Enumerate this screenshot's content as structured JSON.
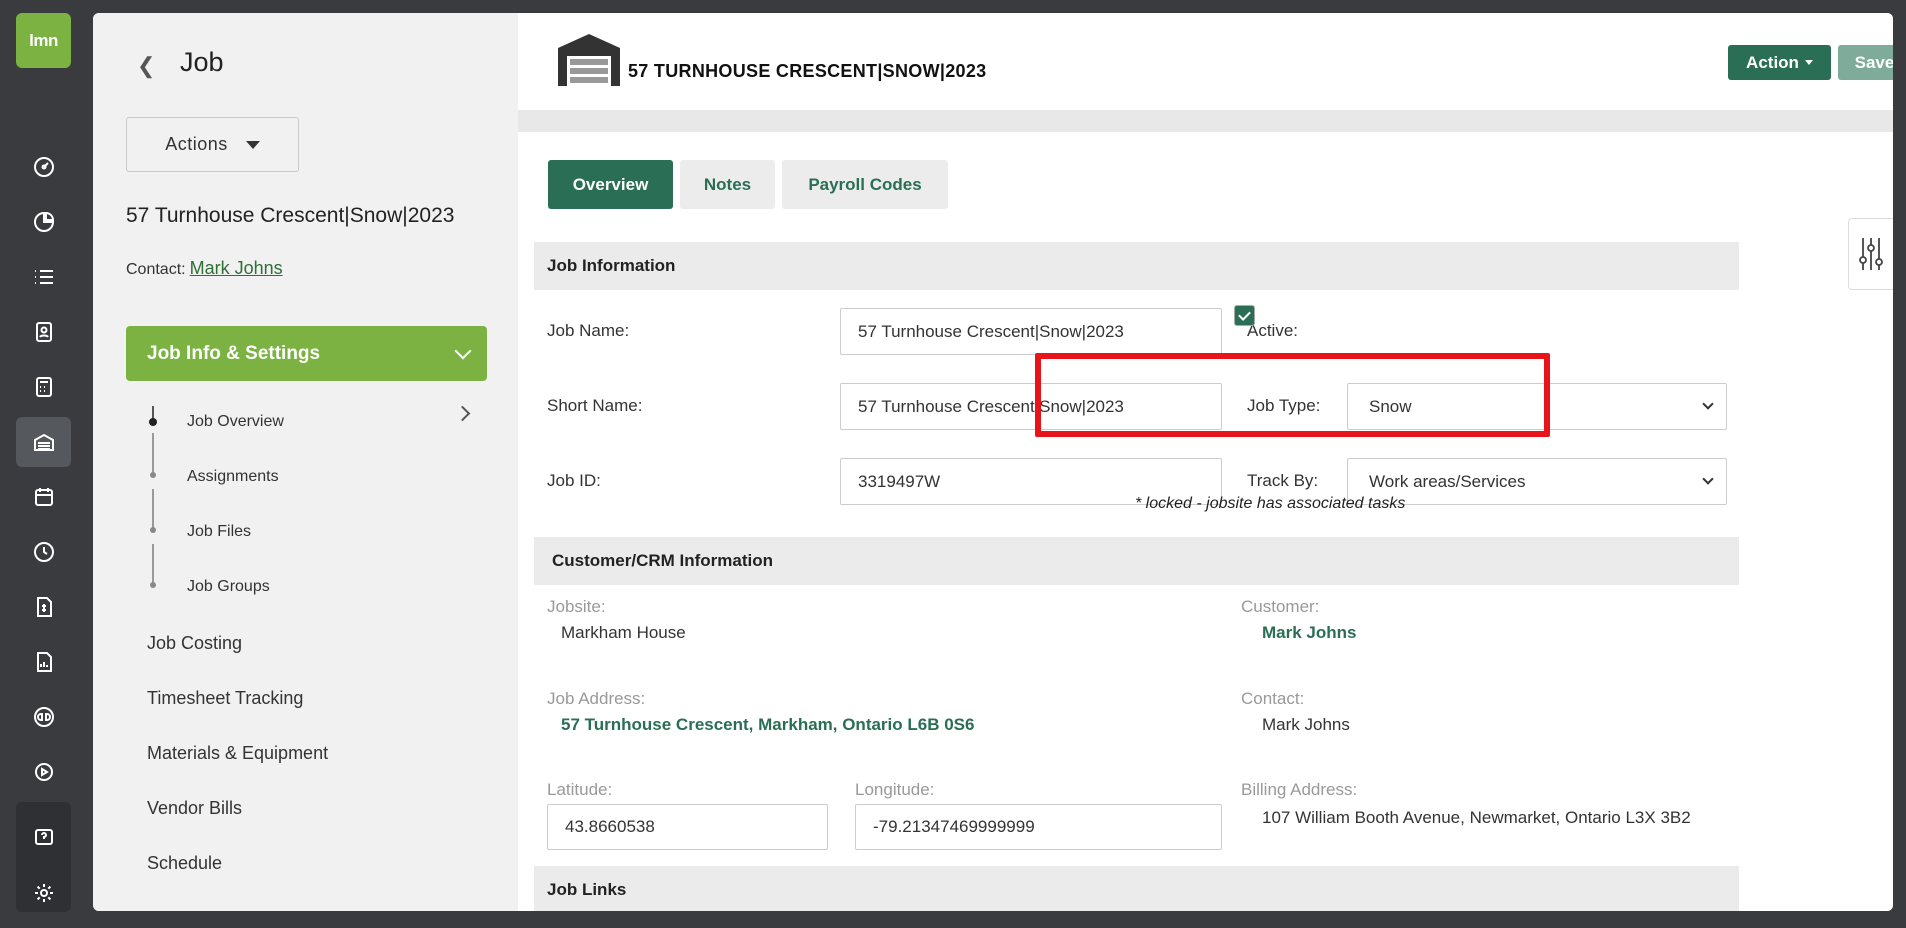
{
  "app": {
    "logo_text": "lmn"
  },
  "rail": {
    "icons": [
      "dashboard-icon",
      "chart-pie-icon",
      "list-icon",
      "contact-card-icon",
      "calculator-icon",
      "garage-icon",
      "calendar-icon",
      "clock-icon",
      "invoice-icon",
      "report-icon",
      "quickbooks-icon",
      "play-icon",
      "help-icon",
      "settings-icon"
    ],
    "active": "garage-icon"
  },
  "nav": {
    "title": "Job",
    "actions_label": "Actions",
    "job_name": "57 Turnhouse Crescent|Snow|2023",
    "contact_label": "Contact:",
    "contact_name": "Mark Johns",
    "section_label": "Job Info & Settings",
    "sub_items": [
      "Job Overview",
      "Assignments",
      "Job Files",
      "Job Groups"
    ],
    "items": [
      "Job Costing",
      "Timesheet Tracking",
      "Materials & Equipment",
      "Vendor Bills",
      "Schedule"
    ]
  },
  "header": {
    "title": "57 TURNHOUSE CRESCENT|SNOW|2023",
    "action_label": "Action",
    "save_label": "Save"
  },
  "tabs": [
    {
      "label": "Overview",
      "active": true
    },
    {
      "label": "Notes",
      "active": false
    },
    {
      "label": "Payroll Codes",
      "active": false
    }
  ],
  "job_info": {
    "heading": "Job Information",
    "job_name_label": "Job Name:",
    "job_name_value": "57 Turnhouse Crescent|Snow|2023",
    "short_name_label": "Short Name:",
    "short_name_value": "57 Turnhouse Crescent|Snow|2023",
    "job_id_label": "Job ID:",
    "job_id_value": "3319497W",
    "active_label": "Active:",
    "active_checked": true,
    "job_type_label": "Job Type:",
    "job_type_value": "Snow",
    "track_by_label": "Track By:",
    "track_by_value": "Work areas/Services",
    "locked_note": "* locked - jobsite has associated tasks"
  },
  "crm": {
    "heading": "Customer/CRM Information",
    "jobsite_label": "Jobsite:",
    "jobsite_value": "Markham House",
    "customer_label": "Customer:",
    "customer_value": "Mark Johns",
    "address_label": "Job Address:",
    "address_value": "57 Turnhouse Crescent, Markham, Ontario L6B 0S6",
    "contact_label": "Contact:",
    "contact_value": "Mark Johns",
    "latitude_label": "Latitude:",
    "latitude_value": "43.8660538",
    "longitude_label": "Longitude:",
    "longitude_value": "-79.21347469999999",
    "billing_label": "Billing Address:",
    "billing_value": "107 William Booth Avenue, Newmarket, Ontario L3X 3B2"
  },
  "links": {
    "heading": "Job Links"
  },
  "colors": {
    "brand_green": "#7bb241",
    "accent": "#2a6f55",
    "highlight": "#e8141a"
  }
}
